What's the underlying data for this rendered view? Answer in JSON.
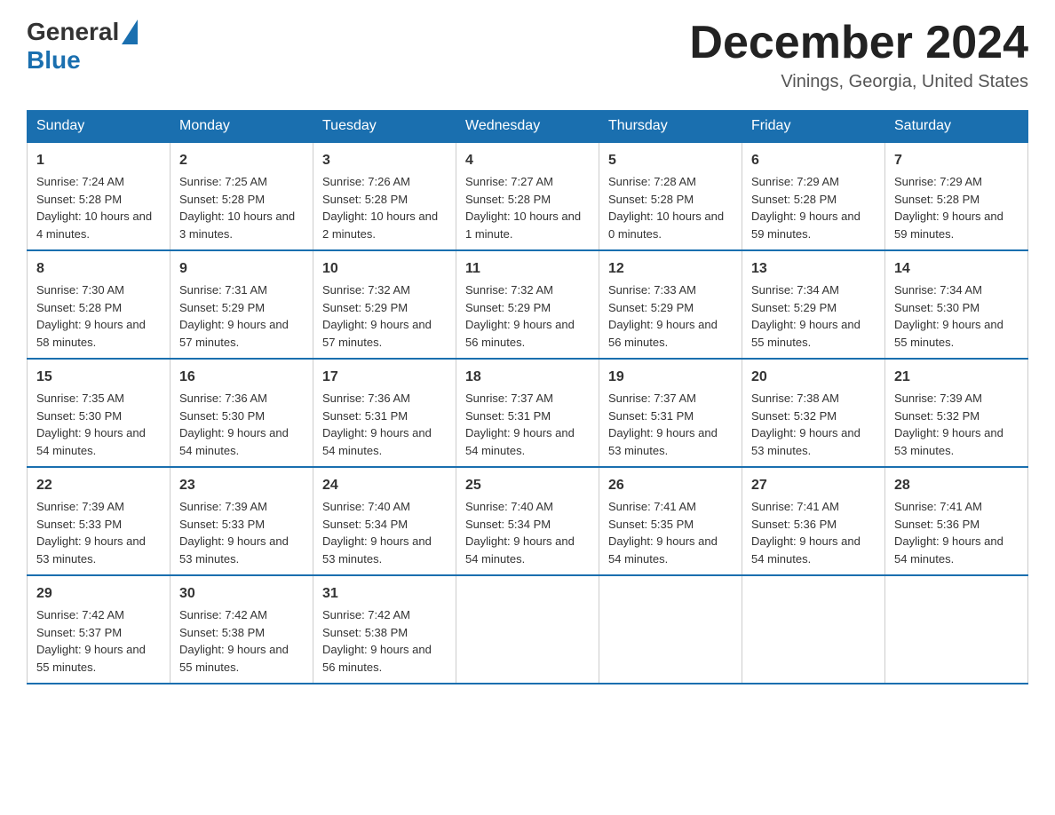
{
  "logo": {
    "general": "General",
    "blue": "Blue"
  },
  "title": "December 2024",
  "location": "Vinings, Georgia, United States",
  "days_of_week": [
    "Sunday",
    "Monday",
    "Tuesday",
    "Wednesday",
    "Thursday",
    "Friday",
    "Saturday"
  ],
  "weeks": [
    [
      {
        "day": "1",
        "sunrise": "Sunrise: 7:24 AM",
        "sunset": "Sunset: 5:28 PM",
        "daylight": "Daylight: 10 hours and 4 minutes."
      },
      {
        "day": "2",
        "sunrise": "Sunrise: 7:25 AM",
        "sunset": "Sunset: 5:28 PM",
        "daylight": "Daylight: 10 hours and 3 minutes."
      },
      {
        "day": "3",
        "sunrise": "Sunrise: 7:26 AM",
        "sunset": "Sunset: 5:28 PM",
        "daylight": "Daylight: 10 hours and 2 minutes."
      },
      {
        "day": "4",
        "sunrise": "Sunrise: 7:27 AM",
        "sunset": "Sunset: 5:28 PM",
        "daylight": "Daylight: 10 hours and 1 minute."
      },
      {
        "day": "5",
        "sunrise": "Sunrise: 7:28 AM",
        "sunset": "Sunset: 5:28 PM",
        "daylight": "Daylight: 10 hours and 0 minutes."
      },
      {
        "day": "6",
        "sunrise": "Sunrise: 7:29 AM",
        "sunset": "Sunset: 5:28 PM",
        "daylight": "Daylight: 9 hours and 59 minutes."
      },
      {
        "day": "7",
        "sunrise": "Sunrise: 7:29 AM",
        "sunset": "Sunset: 5:28 PM",
        "daylight": "Daylight: 9 hours and 59 minutes."
      }
    ],
    [
      {
        "day": "8",
        "sunrise": "Sunrise: 7:30 AM",
        "sunset": "Sunset: 5:28 PM",
        "daylight": "Daylight: 9 hours and 58 minutes."
      },
      {
        "day": "9",
        "sunrise": "Sunrise: 7:31 AM",
        "sunset": "Sunset: 5:29 PM",
        "daylight": "Daylight: 9 hours and 57 minutes."
      },
      {
        "day": "10",
        "sunrise": "Sunrise: 7:32 AM",
        "sunset": "Sunset: 5:29 PM",
        "daylight": "Daylight: 9 hours and 57 minutes."
      },
      {
        "day": "11",
        "sunrise": "Sunrise: 7:32 AM",
        "sunset": "Sunset: 5:29 PM",
        "daylight": "Daylight: 9 hours and 56 minutes."
      },
      {
        "day": "12",
        "sunrise": "Sunrise: 7:33 AM",
        "sunset": "Sunset: 5:29 PM",
        "daylight": "Daylight: 9 hours and 56 minutes."
      },
      {
        "day": "13",
        "sunrise": "Sunrise: 7:34 AM",
        "sunset": "Sunset: 5:29 PM",
        "daylight": "Daylight: 9 hours and 55 minutes."
      },
      {
        "day": "14",
        "sunrise": "Sunrise: 7:34 AM",
        "sunset": "Sunset: 5:30 PM",
        "daylight": "Daylight: 9 hours and 55 minutes."
      }
    ],
    [
      {
        "day": "15",
        "sunrise": "Sunrise: 7:35 AM",
        "sunset": "Sunset: 5:30 PM",
        "daylight": "Daylight: 9 hours and 54 minutes."
      },
      {
        "day": "16",
        "sunrise": "Sunrise: 7:36 AM",
        "sunset": "Sunset: 5:30 PM",
        "daylight": "Daylight: 9 hours and 54 minutes."
      },
      {
        "day": "17",
        "sunrise": "Sunrise: 7:36 AM",
        "sunset": "Sunset: 5:31 PM",
        "daylight": "Daylight: 9 hours and 54 minutes."
      },
      {
        "day": "18",
        "sunrise": "Sunrise: 7:37 AM",
        "sunset": "Sunset: 5:31 PM",
        "daylight": "Daylight: 9 hours and 54 minutes."
      },
      {
        "day": "19",
        "sunrise": "Sunrise: 7:37 AM",
        "sunset": "Sunset: 5:31 PM",
        "daylight": "Daylight: 9 hours and 53 minutes."
      },
      {
        "day": "20",
        "sunrise": "Sunrise: 7:38 AM",
        "sunset": "Sunset: 5:32 PM",
        "daylight": "Daylight: 9 hours and 53 minutes."
      },
      {
        "day": "21",
        "sunrise": "Sunrise: 7:39 AM",
        "sunset": "Sunset: 5:32 PM",
        "daylight": "Daylight: 9 hours and 53 minutes."
      }
    ],
    [
      {
        "day": "22",
        "sunrise": "Sunrise: 7:39 AM",
        "sunset": "Sunset: 5:33 PM",
        "daylight": "Daylight: 9 hours and 53 minutes."
      },
      {
        "day": "23",
        "sunrise": "Sunrise: 7:39 AM",
        "sunset": "Sunset: 5:33 PM",
        "daylight": "Daylight: 9 hours and 53 minutes."
      },
      {
        "day": "24",
        "sunrise": "Sunrise: 7:40 AM",
        "sunset": "Sunset: 5:34 PM",
        "daylight": "Daylight: 9 hours and 53 minutes."
      },
      {
        "day": "25",
        "sunrise": "Sunrise: 7:40 AM",
        "sunset": "Sunset: 5:34 PM",
        "daylight": "Daylight: 9 hours and 54 minutes."
      },
      {
        "day": "26",
        "sunrise": "Sunrise: 7:41 AM",
        "sunset": "Sunset: 5:35 PM",
        "daylight": "Daylight: 9 hours and 54 minutes."
      },
      {
        "day": "27",
        "sunrise": "Sunrise: 7:41 AM",
        "sunset": "Sunset: 5:36 PM",
        "daylight": "Daylight: 9 hours and 54 minutes."
      },
      {
        "day": "28",
        "sunrise": "Sunrise: 7:41 AM",
        "sunset": "Sunset: 5:36 PM",
        "daylight": "Daylight: 9 hours and 54 minutes."
      }
    ],
    [
      {
        "day": "29",
        "sunrise": "Sunrise: 7:42 AM",
        "sunset": "Sunset: 5:37 PM",
        "daylight": "Daylight: 9 hours and 55 minutes."
      },
      {
        "day": "30",
        "sunrise": "Sunrise: 7:42 AM",
        "sunset": "Sunset: 5:38 PM",
        "daylight": "Daylight: 9 hours and 55 minutes."
      },
      {
        "day": "31",
        "sunrise": "Sunrise: 7:42 AM",
        "sunset": "Sunset: 5:38 PM",
        "daylight": "Daylight: 9 hours and 56 minutes."
      },
      null,
      null,
      null,
      null
    ]
  ]
}
